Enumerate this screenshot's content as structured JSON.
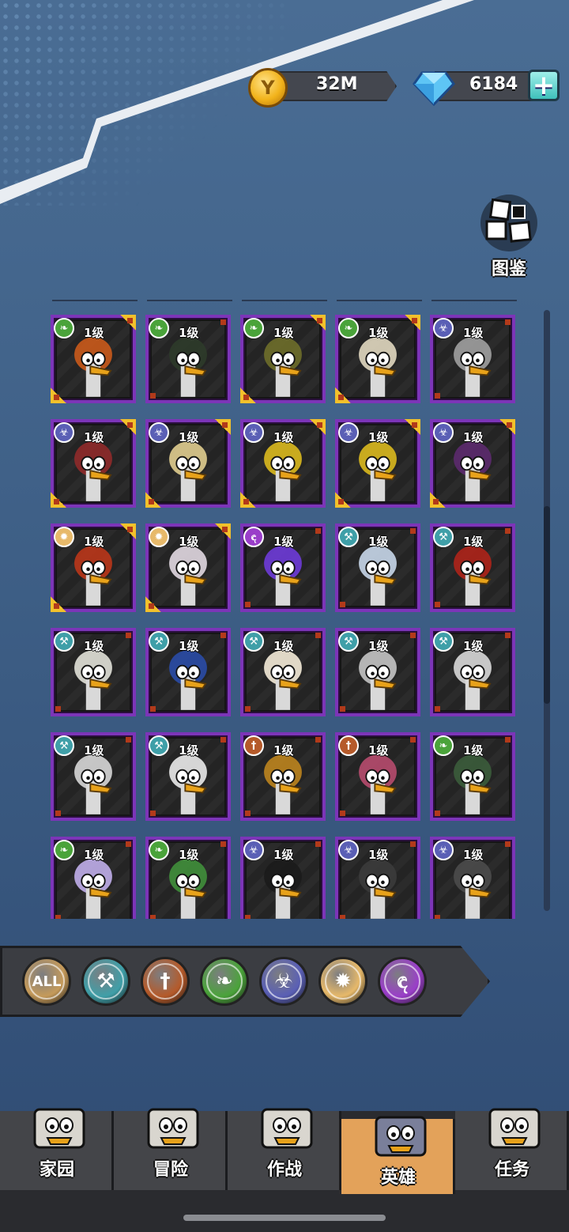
{
  "currency": {
    "coins": "32M",
    "gems": "6184",
    "add_label": "+"
  },
  "codex": {
    "label": "图鉴"
  },
  "colors": {
    "card_border": "#7c35b8",
    "gold_corner": "#f2c12b",
    "active_tab": "#e3a25a"
  },
  "heroes": [
    {
      "level": "1级",
      "element": "nature",
      "corners": true
    },
    {
      "level": "1级",
      "element": "nature",
      "corners": false
    },
    {
      "level": "1级",
      "element": "nature",
      "corners": true
    },
    {
      "level": "1级",
      "element": "nature",
      "corners": true
    },
    {
      "level": "1级",
      "element": "biohazard",
      "corners": false
    },
    {
      "level": "1级",
      "element": "biohazard",
      "corners": true
    },
    {
      "level": "1级",
      "element": "biohazard",
      "corners": true
    },
    {
      "level": "1级",
      "element": "biohazard",
      "corners": true
    },
    {
      "level": "1级",
      "element": "biohazard",
      "corners": true
    },
    {
      "level": "1级",
      "element": "biohazard",
      "corners": true
    },
    {
      "level": "1级",
      "element": "light",
      "corners": true
    },
    {
      "level": "1级",
      "element": "light",
      "corners": true
    },
    {
      "level": "1级",
      "element": "arcane",
      "corners": false
    },
    {
      "level": "1级",
      "element": "tech",
      "corners": false
    },
    {
      "level": "1级",
      "element": "tech",
      "corners": false
    },
    {
      "level": "1级",
      "element": "tech",
      "corners": false
    },
    {
      "level": "1级",
      "element": "tech",
      "corners": false
    },
    {
      "level": "1级",
      "element": "tech",
      "corners": false
    },
    {
      "level": "1级",
      "element": "tech",
      "corners": false
    },
    {
      "level": "1级",
      "element": "tech",
      "corners": false
    },
    {
      "level": "1级",
      "element": "tech",
      "corners": false
    },
    {
      "level": "1级",
      "element": "tech",
      "corners": false
    },
    {
      "level": "1级",
      "element": "fire",
      "corners": false
    },
    {
      "level": "1级",
      "element": "fire",
      "corners": false
    },
    {
      "level": "1级",
      "element": "nature",
      "corners": false
    },
    {
      "level": "1级",
      "element": "nature",
      "corners": false
    },
    {
      "level": "1级",
      "element": "nature",
      "corners": false
    },
    {
      "level": "1级",
      "element": "biohazard",
      "corners": false
    },
    {
      "level": "1级",
      "element": "biohazard",
      "corners": false
    },
    {
      "level": "1级",
      "element": "biohazard",
      "corners": false
    }
  ],
  "filters": [
    {
      "label": "ALL",
      "icon": "all-icon",
      "color": "#c59a5a"
    },
    {
      "label": "",
      "icon": "tech-wrench-icon",
      "color": "#3f9fa8"
    },
    {
      "label": "",
      "icon": "blade-icon",
      "color": "#b55a2a"
    },
    {
      "label": "",
      "icon": "leaf-icon",
      "color": "#4aa33a"
    },
    {
      "label": "",
      "icon": "biohazard-icon",
      "color": "#5a5fb5"
    },
    {
      "label": "",
      "icon": "sun-icon",
      "color": "#e7b96a"
    },
    {
      "label": "",
      "icon": "arcane-icon",
      "color": "#9a3ec9"
    }
  ],
  "nav": [
    {
      "label": "家园",
      "icon": "castle-icon",
      "active": false
    },
    {
      "label": "冒险",
      "icon": "sword-duck-icon",
      "active": false
    },
    {
      "label": "作战",
      "icon": "shield-icon",
      "active": false
    },
    {
      "label": "英雄",
      "icon": "hero-book-icon",
      "active": true
    },
    {
      "label": "任务",
      "icon": "scroll-icon",
      "active": false
    }
  ]
}
